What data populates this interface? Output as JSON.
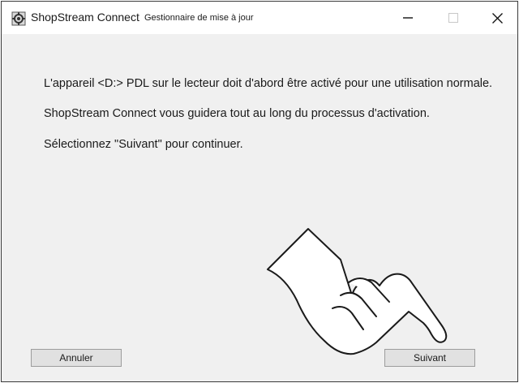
{
  "window": {
    "app_name": "ShopStream Connect",
    "subtitle": "Gestionnaire de mise à jour",
    "minimize_glyph": "—",
    "close_glyph": "✕",
    "app_icon": "gear-icon"
  },
  "content": {
    "lines": [
      "L'appareil <D:> PDL sur le lecteur doit d'abord être activé pour une utilisation normale.",
      "ShopStream Connect vous guidera tout au long du processus d'activation.",
      "Sélectionnez \"Suivant\" pour continuer."
    ],
    "pointer_icon": "pointing-hand-icon"
  },
  "buttons": {
    "cancel_label": "Annuler",
    "next_label": "Suivant"
  }
}
